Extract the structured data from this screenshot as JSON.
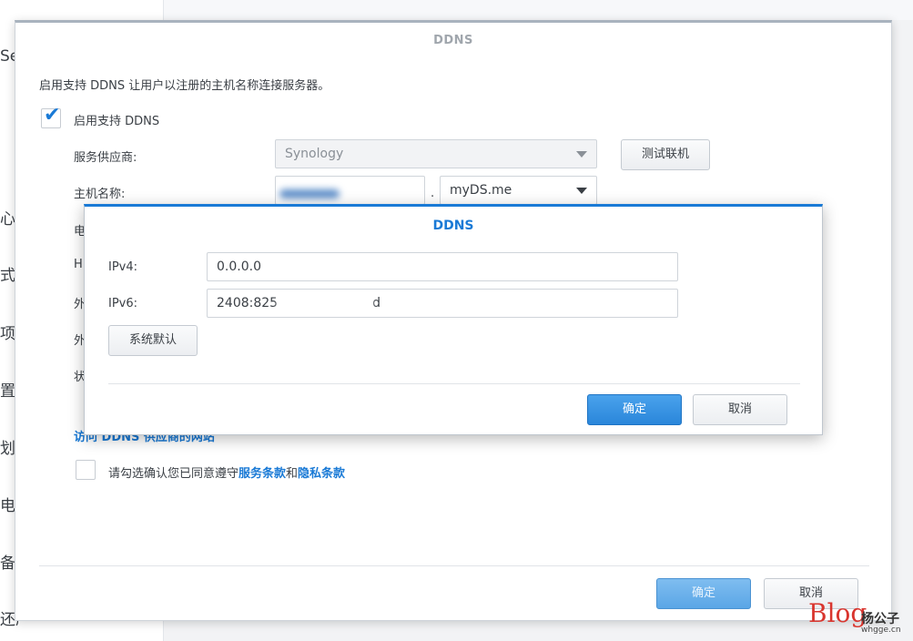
{
  "sidebar_fragments": [
    "Ser",
    "心",
    "式",
    "项",
    "置",
    "划",
    "电池",
    "备",
    "还原"
  ],
  "main_window": {
    "title": "DDNS",
    "intro": "启用支持 DDNS 让用户以注册的主机名称连接服务器。",
    "enable_label": "启用支持 DDNS",
    "enable_checked": true,
    "provider_label": "服务供应商:",
    "provider_value": "Synology",
    "test_button": "测试联机",
    "hostname_label": "主机名称:",
    "hostname_dot": ".",
    "domain_value": "myDS.me",
    "hidden_label_fragments": [
      "电",
      "H",
      "外",
      "外",
      "状"
    ],
    "access_link": "访问 DDNS 供应商的网站",
    "agree_prefix": "请勾选确认您已同意遵守",
    "agree_terms": "服务条款",
    "agree_and": "和",
    "agree_privacy": "隐私条款",
    "agree_checked": false,
    "ok_button": "确定",
    "cancel_button": "取消"
  },
  "dialog": {
    "title": "DDNS",
    "ipv4_label": "IPv4:",
    "ipv4_value": "0.0.0.0",
    "ipv6_label": "IPv6:",
    "ipv6_value_start": "2408:825",
    "ipv6_value_end": "d",
    "default_button": "系统默认",
    "ok_button": "确定",
    "cancel_button": "取消"
  },
  "watermark": {
    "blog": "Blog",
    "name": "杨公子",
    "url": "whgge.cn"
  },
  "colors": {
    "accent": "#1a7ad6",
    "primary_button": "#2a86da",
    "brand_red": "#d9352e"
  }
}
